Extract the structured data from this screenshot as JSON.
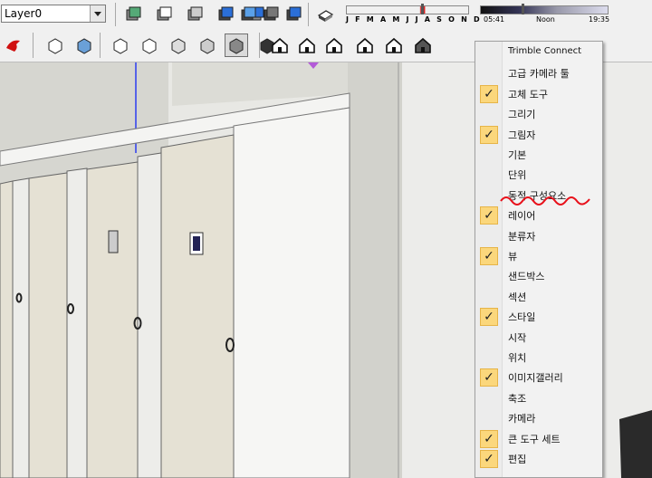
{
  "toolbar": {
    "layer_value": "Layer0",
    "months_label": "J F M A M J J A S O N D",
    "month_position": 0.62,
    "time_start": "05:41",
    "time_noon": "Noon",
    "time_end": "19:35",
    "time_position": 0.33,
    "row1_icons": [
      "orbit-box-icon",
      "xray-box-icon",
      "back-edges-icon",
      "wireframe-icon",
      "hidden-line-icon",
      "shaded-icon",
      "shaded-textures-icon",
      "monochrome-icon",
      "shadows-toggle-icon"
    ],
    "row2_icons": [
      "red-tool-icon",
      "iso-view-icon",
      "top-view-icon",
      "front-view-icon",
      "right-view-icon",
      "back-view-icon",
      "left-view-icon",
      "style-icon",
      "texture-style-icon",
      "house-icon",
      "door-panel-icon",
      "home-outline-icon",
      "home-section-icon",
      "home-plain-icon",
      "home-dark-icon"
    ]
  },
  "menu": {
    "items": [
      {
        "label": "Trimble Connect",
        "checked": false
      },
      {
        "label": "고급 카메라 툴",
        "checked": false
      },
      {
        "label": "고체 도구",
        "checked": true
      },
      {
        "label": "그리기",
        "checked": false
      },
      {
        "label": "그림자",
        "checked": true
      },
      {
        "label": "기본",
        "checked": false
      },
      {
        "label": "단위",
        "checked": false
      },
      {
        "label": "동적 구성요소",
        "checked": false
      },
      {
        "label": "레이어",
        "checked": true
      },
      {
        "label": "분류자",
        "checked": false
      },
      {
        "label": "뷰",
        "checked": true
      },
      {
        "label": "샌드박스",
        "checked": false
      },
      {
        "label": "섹션",
        "checked": false
      },
      {
        "label": "스타일",
        "checked": true
      },
      {
        "label": "시작",
        "checked": false
      },
      {
        "label": "위치",
        "checked": false
      },
      {
        "label": "이미지갤러리",
        "checked": true
      },
      {
        "label": "축조",
        "checked": false
      },
      {
        "label": "카메라",
        "checked": false
      },
      {
        "label": "큰 도구 세트",
        "checked": true
      },
      {
        "label": "편집",
        "checked": true
      }
    ]
  },
  "colors": {
    "check_bg": "#fbd77c",
    "annotation": "#e8101a",
    "door": "#e5e1d4"
  }
}
